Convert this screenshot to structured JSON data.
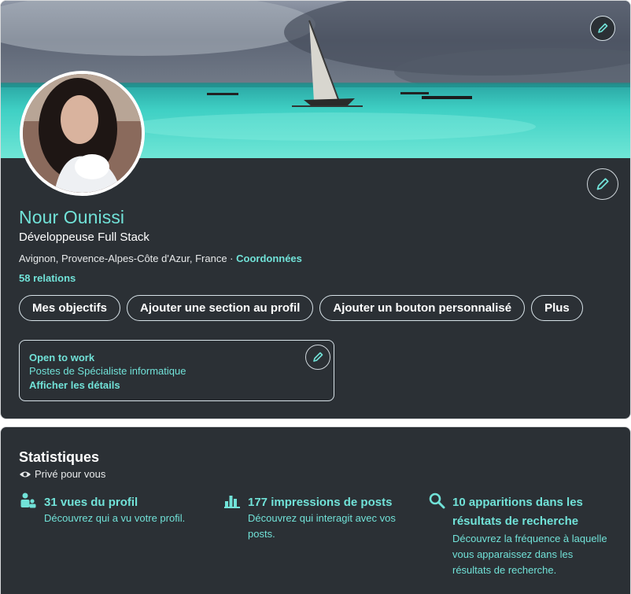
{
  "profile": {
    "name": "Nour Ounissi",
    "headline": "Développeuse Full Stack",
    "location": "Avignon, Provence-Alpes-Côte d'Azur, France",
    "separator": " · ",
    "contact_link": "Coordonnées",
    "relations": "58 relations"
  },
  "actions": [
    {
      "label": "Mes objectifs"
    },
    {
      "label": "Ajouter une section au profil"
    },
    {
      "label": "Ajouter un bouton personnalisé"
    },
    {
      "label": "Plus"
    }
  ],
  "open_to_work": {
    "title": "Open to work",
    "subtitle": "Postes de Spécialiste informatique",
    "link": "Afficher les détails"
  },
  "stats": {
    "title": "Statistiques",
    "privacy": "Privé pour vous",
    "items": [
      {
        "icon": "people-icon",
        "title": "31 vues du profil",
        "desc_lines": [
          "Découvrez qui a vu votre profil."
        ]
      },
      {
        "icon": "bar-chart-icon",
        "title": "177 impressions de posts",
        "desc_lines": [
          "Découvrez qui interagit avec vos",
          "posts."
        ]
      },
      {
        "icon": "search-icon",
        "title_lines": [
          "10 apparitions dans les",
          "résultats de recherche"
        ],
        "desc_lines": [
          "Découvrez la fréquence à laquelle",
          "vous apparaissez dans les",
          "résultats de recherche."
        ]
      }
    ]
  },
  "colors": {
    "accent": "#71e2d8",
    "card_bg": "#2b3035",
    "text": "#ffffff"
  }
}
